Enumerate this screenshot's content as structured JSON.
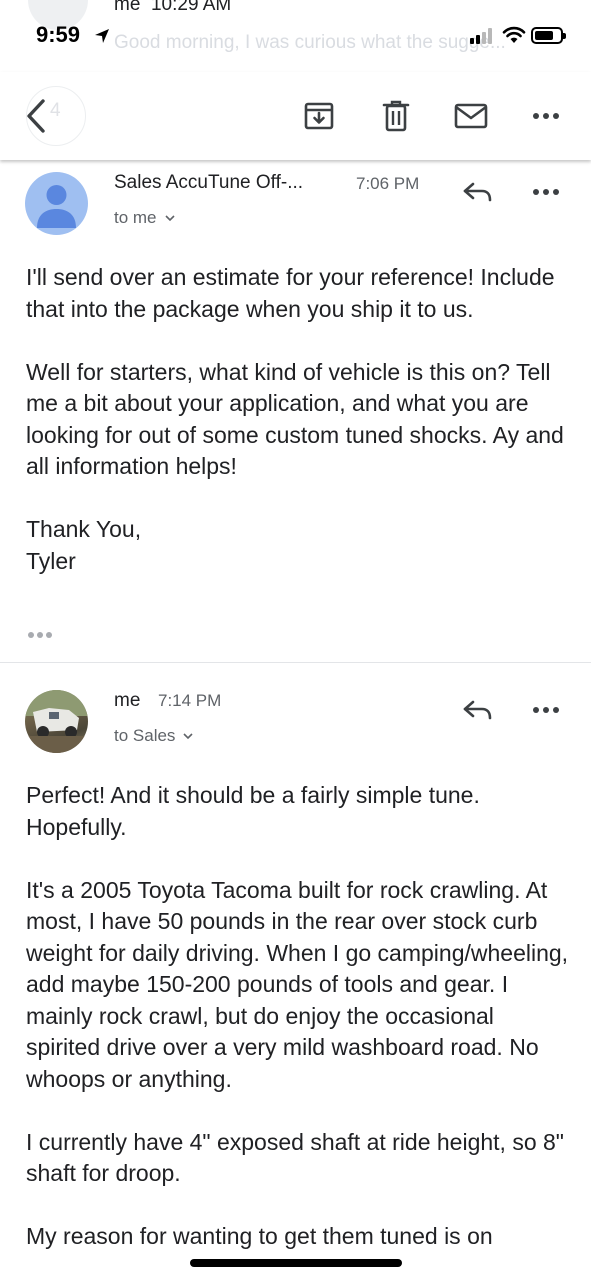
{
  "background_header": {
    "sender": "me",
    "time": "10:29 AM",
    "snippet": "Good morning, I was curious what the sugge...",
    "count": "4"
  },
  "status_bar": {
    "time": "9:59"
  },
  "toolbar": {
    "actions": [
      "back-icon",
      "archive-icon",
      "delete-icon",
      "mark-unread-icon",
      "more-icon"
    ]
  },
  "messages": [
    {
      "sender": "Sales AccuTune Off-...",
      "time": "7:06 PM",
      "recipients": "to me",
      "avatar_color": "#9fbff1",
      "paragraphs": [
        "I'll send over an estimate for your reference! Include that into the package when you ship it to us.",
        "Well for starters, what kind of vehicle is this on? Tell me a bit about your application, and what you are looking for out of some custom tuned shocks. Ay and all information helps!",
        "Thank You,\nTyler"
      ]
    },
    {
      "sender": "me",
      "time": "7:14 PM",
      "recipients": "to Sales",
      "paragraphs": [
        "Perfect! And it should be a fairly simple tune. Hopefully.",
        "It's a 2005 Toyota Tacoma built for rock crawling. At most, I have 50 pounds in the rear over stock curb weight for daily driving. When I go camping/wheeling, add maybe 150-200 pounds of tools and gear. I mainly rock crawl, but do enjoy the occasional spirited drive over a very mild washboard road. No whoops or anything.",
        "I currently have 4\" exposed shaft at ride height, so 8\" shaft for droop.",
        "My reason for wanting to get them tuned is on"
      ]
    }
  ],
  "colors": {
    "avatar_generic": "#9fbff1",
    "avatar_icon": "#5a87df",
    "icon": "#3c4043",
    "secondary_text": "#5f6368"
  }
}
